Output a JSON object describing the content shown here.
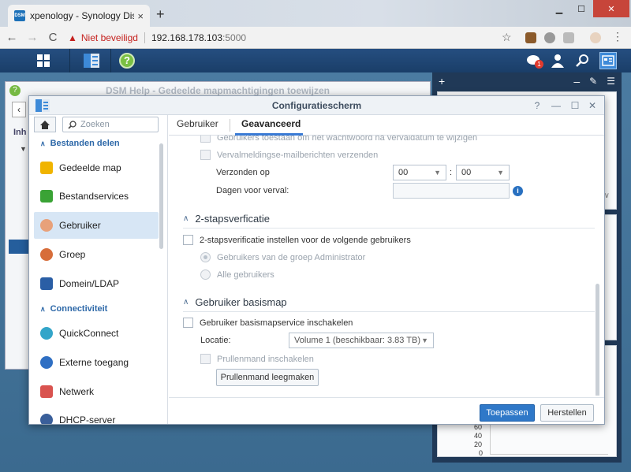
{
  "browser": {
    "tab_title": "xpenology - Synology DiskStation",
    "tab_favicon": "DSM",
    "new_tab": "+",
    "tab_close": "×",
    "security_label": "Niet beveiligd",
    "url_host": "192.168.178.103",
    "url_port": ":5000",
    "back": "←",
    "forward": "→",
    "reload": "C",
    "star": "☆"
  },
  "taskbar": {
    "help_icon": "?",
    "notification_count": "1"
  },
  "background_window": {
    "title": "DSM Help - Gedeelde mapmachtigingen toewijzen",
    "help_icon": "?",
    "back": "‹",
    "content_label": "Inh"
  },
  "right_panel": {
    "add": "+",
    "minimize": "–",
    "axis_labels": [
      "60",
      "40",
      "20",
      "0"
    ]
  },
  "window": {
    "title": "Configuratiescherm",
    "help": "?",
    "minimize": "—",
    "maximize": "☐",
    "close": "✕"
  },
  "sidebar": {
    "search_placeholder": "Zoeken",
    "group_files": "Bestanden delen",
    "group_connectivity": "Connectiviteit",
    "items": [
      {
        "label": "Gedeelde map",
        "color": "#f0b400"
      },
      {
        "label": "Bestandservices",
        "color": "#3aa335"
      },
      {
        "label": "Gebruiker",
        "color": "#e8a17a"
      },
      {
        "label": "Groep",
        "color": "#d76d3a"
      },
      {
        "label": "Domein/LDAP",
        "color": "#2a5ea5"
      },
      {
        "label": "QuickConnect",
        "color": "#33a5c9"
      },
      {
        "label": "Externe toegang",
        "color": "#2f6fc3"
      },
      {
        "label": "Netwerk",
        "color": "#d9534f"
      },
      {
        "label": "DHCP-server",
        "color": "#3a5f9a"
      }
    ]
  },
  "tabs": {
    "user": "Gebruiker",
    "advanced": "Geavanceerd"
  },
  "advanced": {
    "allow_reset_partial": "Gebruikers toestaan om het wachtwoord na vervaldatum te wijzigen",
    "expiry_mail": "Vervalmeldingse-mailberichten verzenden",
    "sent_on": "Verzonden op",
    "hour": "00",
    "minute": "00",
    "time_sep": ":",
    "days_before": "Dagen voor verval:",
    "info": "i",
    "twofa_title": "2-stapsverficatie",
    "twofa_enable": "2-stapsverificatie instellen voor de volgende gebruikers",
    "twofa_admin": "Gebruikers van de groep Administrator",
    "twofa_all": "Alle gebruikers",
    "home_title": "Gebruiker basismap",
    "home_enable": "Gebruiker basismapservice inschakelen",
    "location": "Locatie:",
    "location_value": "Volume 1 (beschikbaar: 3.83 TB)",
    "recycle_enable": "Prullenmand inschakelen",
    "recycle_empty": "Prullenmand leegmaken"
  },
  "footer": {
    "apply": "Toepassen",
    "reset": "Herstellen"
  }
}
